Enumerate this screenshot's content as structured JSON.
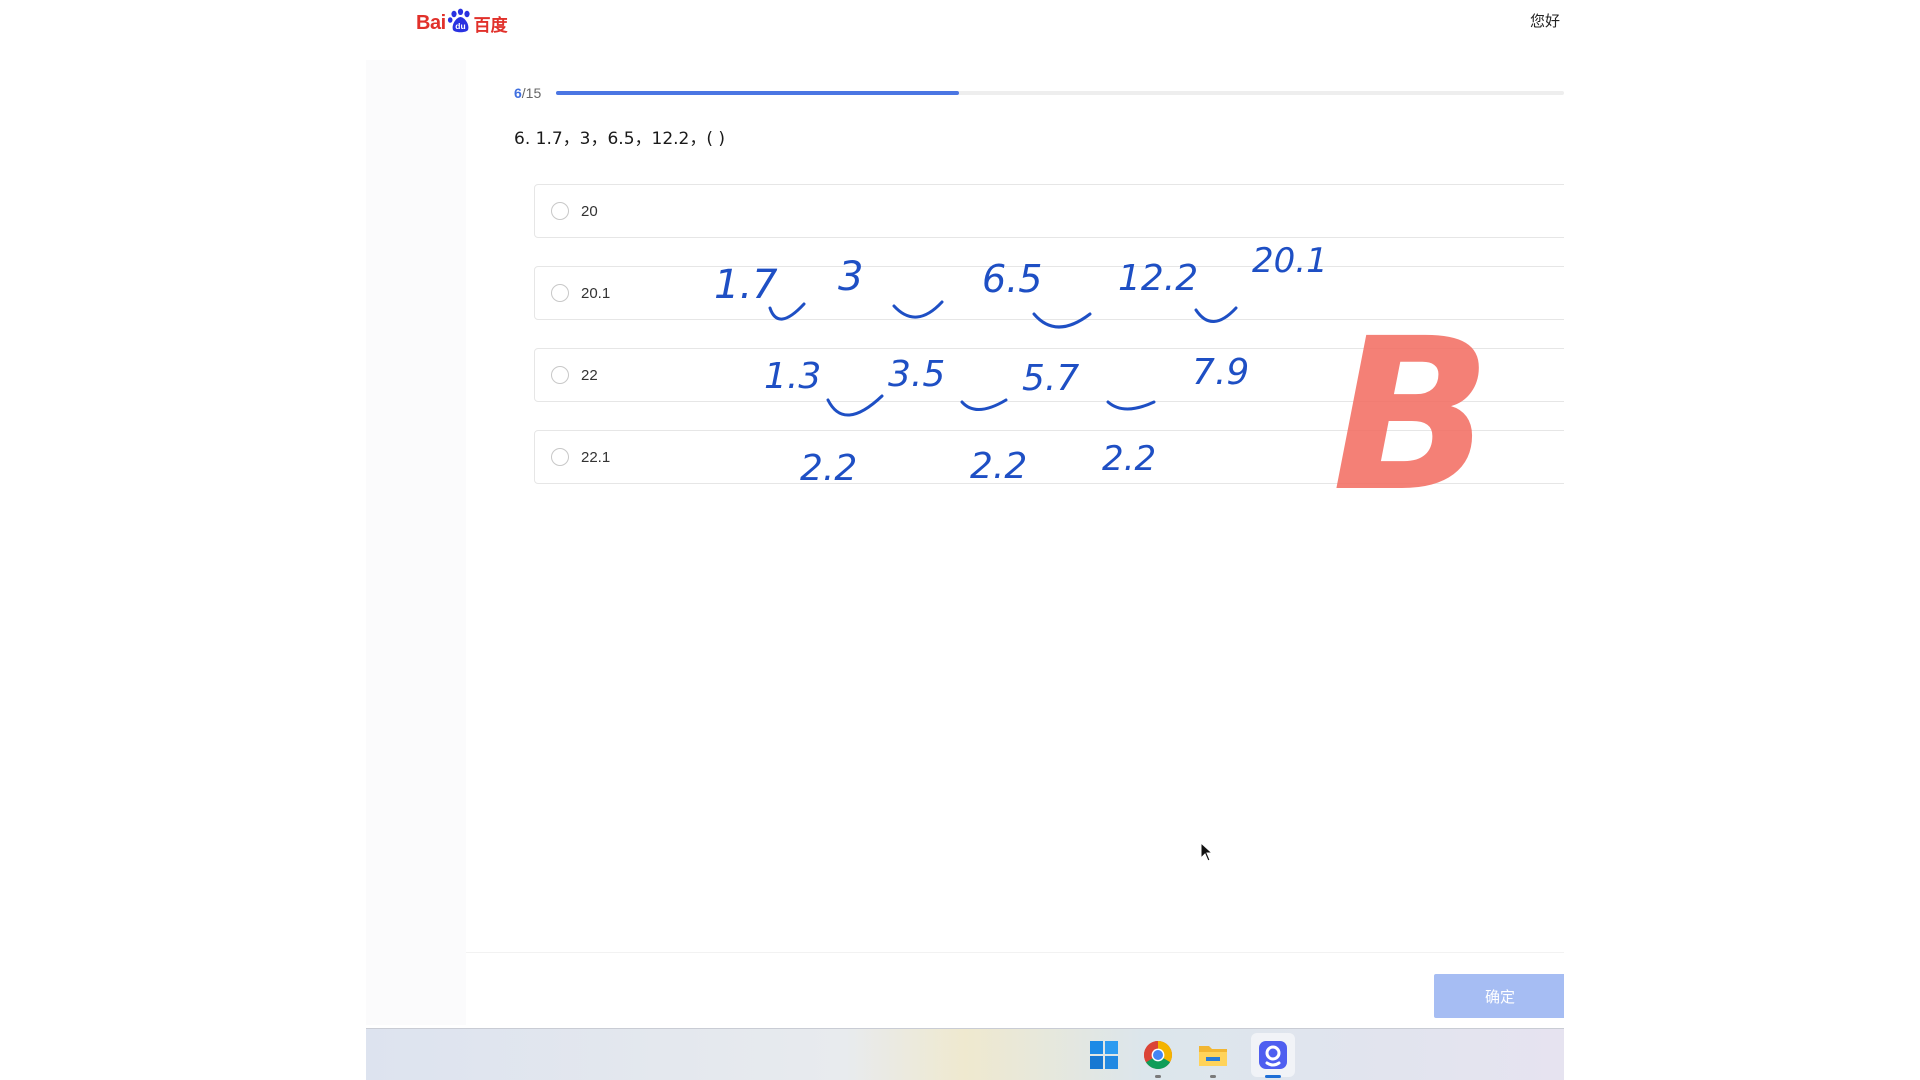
{
  "header": {
    "logo_text_left": "Bai",
    "logo_text_right": "百度",
    "logo_icon": "baidu-paw-icon",
    "greeting": "您好"
  },
  "progress": {
    "current": "6",
    "total": "/15",
    "fraction": 0.4
  },
  "question": {
    "text": "6. 1.7，3，6.5，12.2，( )"
  },
  "options": [
    {
      "label": "20"
    },
    {
      "label": "20.1"
    },
    {
      "label": "22"
    },
    {
      "label": "22.1"
    }
  ],
  "confirm_label": "确定",
  "annotations": {
    "row1": [
      "1.7",
      "3",
      "6.5",
      "12.2",
      "20.1"
    ],
    "row2": [
      "1.3",
      "3.5",
      "5.7",
      "7.9"
    ],
    "row3": [
      "2.2",
      "2.2",
      "2.2"
    ],
    "answer": "B",
    "ink_color": "#1e4fc4",
    "answer_color": "#f26a5e"
  },
  "taskbar": {
    "icons": [
      "windows-start-icon",
      "chrome-icon",
      "file-explorer-icon",
      "app-icon"
    ]
  },
  "colors": {
    "accent": "#4b76e3",
    "button_disabled": "#a6bdf3",
    "logo_red": "#e1302a",
    "logo_blue": "#2932e1"
  }
}
